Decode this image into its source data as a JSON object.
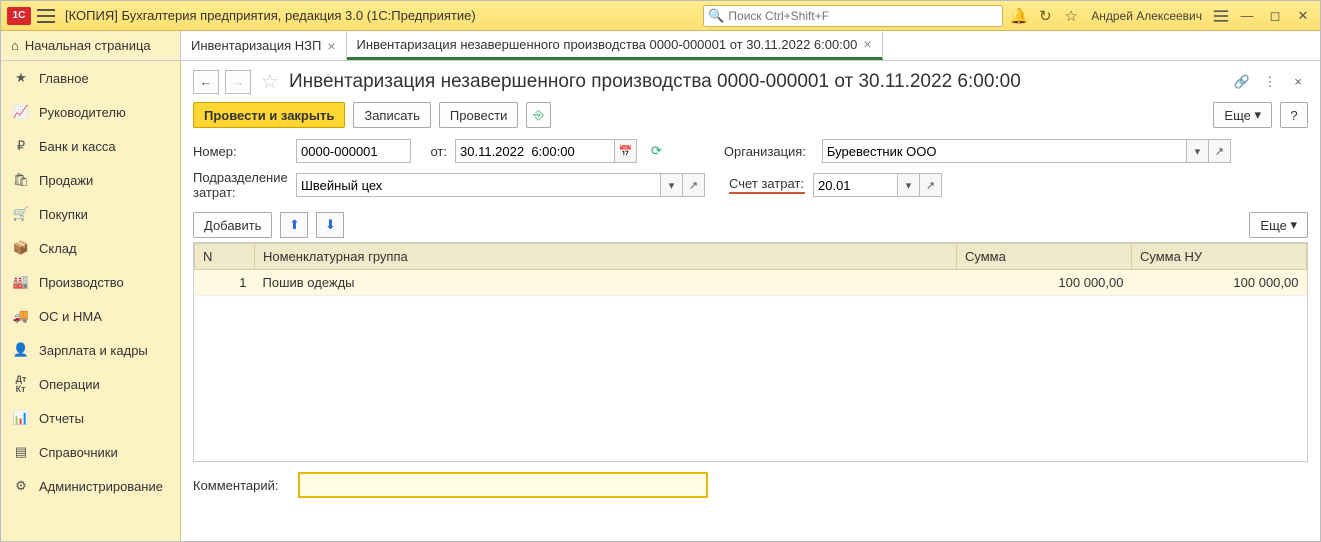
{
  "top": {
    "app_title": "[КОПИЯ] Бухгалтерия предприятия, редакция 3.0  (1С:Предприятие)",
    "search_placeholder": "Поиск Ctrl+Shift+F",
    "username": "Андрей Алексеевич"
  },
  "tabs": {
    "home": "Начальная страница",
    "items": [
      {
        "label": "Инвентаризация НЗП",
        "active": false
      },
      {
        "label": "Инвентаризация незавершенного производства 0000-000001 от 30.11.2022 6:00:00",
        "active": true
      }
    ]
  },
  "sidebar": [
    {
      "label": "Главное",
      "icon": "star"
    },
    {
      "label": "Руководителю",
      "icon": "chart"
    },
    {
      "label": "Банк и касса",
      "icon": "ruble"
    },
    {
      "label": "Продажи",
      "icon": "bag"
    },
    {
      "label": "Покупки",
      "icon": "cart"
    },
    {
      "label": "Склад",
      "icon": "box"
    },
    {
      "label": "Производство",
      "icon": "factory"
    },
    {
      "label": "ОС и НМА",
      "icon": "truck"
    },
    {
      "label": "Зарплата и кадры",
      "icon": "person"
    },
    {
      "label": "Операции",
      "icon": "dtkt"
    },
    {
      "label": "Отчеты",
      "icon": "bars"
    },
    {
      "label": "Справочники",
      "icon": "book"
    },
    {
      "label": "Администрирование",
      "icon": "gear"
    }
  ],
  "doc": {
    "title": "Инвентаризация незавершенного производства 0000-000001 от 30.11.2022 6:00:00",
    "toolbar": {
      "post_close": "Провести и закрыть",
      "write": "Записать",
      "post": "Провести",
      "more": "Еще",
      "help": "?"
    },
    "fields": {
      "number_label": "Номер:",
      "number": "0000-000001",
      "date_label": "от:",
      "date": "30.11.2022  6:00:00",
      "org_label": "Организация:",
      "org": "Буревестник ООО",
      "dept_label1": "Подразделение",
      "dept_label2": "затрат:",
      "dept": "Швейный цех",
      "acct_label": "Счет затрат:",
      "acct": "20.01"
    },
    "table_toolbar": {
      "add": "Добавить",
      "more": "Еще"
    },
    "columns": {
      "n": "N",
      "group": "Номенклатурная группа",
      "sum": "Сумма",
      "sum_nu": "Сумма НУ"
    },
    "rows": [
      {
        "n": "1",
        "group": "Пошив одежды",
        "sum": "100 000,00",
        "sum_nu": "100 000,00"
      }
    ],
    "comment_label": "Комментарий:",
    "comment": ""
  }
}
